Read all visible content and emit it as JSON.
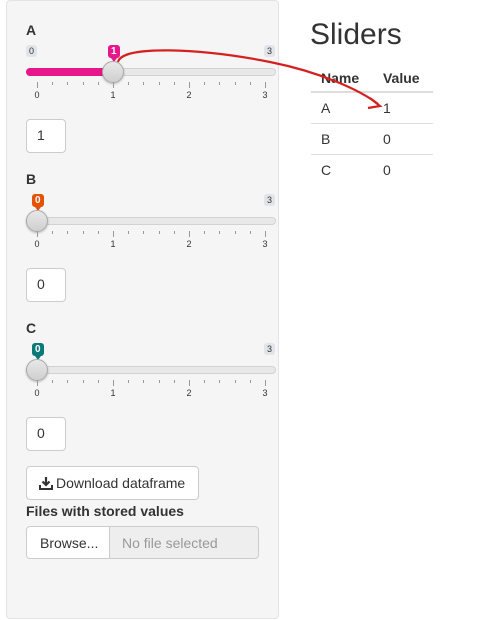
{
  "sidebar": {
    "sliders": [
      {
        "label": "A",
        "min": "0",
        "max": "3",
        "value": "1",
        "value_num": 1,
        "ticks": [
          "0",
          "1",
          "2",
          "3"
        ],
        "color": "#e8168b",
        "numeric_input": "1"
      },
      {
        "label": "B",
        "min": "0",
        "max": "3",
        "value": "0",
        "value_num": 0,
        "ticks": [
          "0",
          "1",
          "2",
          "3"
        ],
        "color": "#e35205",
        "numeric_input": "0"
      },
      {
        "label": "C",
        "min": "0",
        "max": "3",
        "value": "0",
        "value_num": 0,
        "ticks": [
          "0",
          "1",
          "2",
          "3"
        ],
        "color": "#0a7a78",
        "numeric_input": "0"
      }
    ],
    "download_button": {
      "label": "Download dataframe",
      "icon": "download-icon"
    },
    "file_input": {
      "label": "Files with stored values",
      "browse_label": "Browse...",
      "placeholder": "No file selected"
    }
  },
  "main": {
    "title": "Sliders",
    "table": {
      "headers": [
        "Name",
        "Value"
      ],
      "rows": [
        [
          "A",
          "1"
        ],
        [
          "B",
          "0"
        ],
        [
          "C",
          "0"
        ]
      ]
    }
  },
  "annotation": {
    "color": "#d62020"
  }
}
